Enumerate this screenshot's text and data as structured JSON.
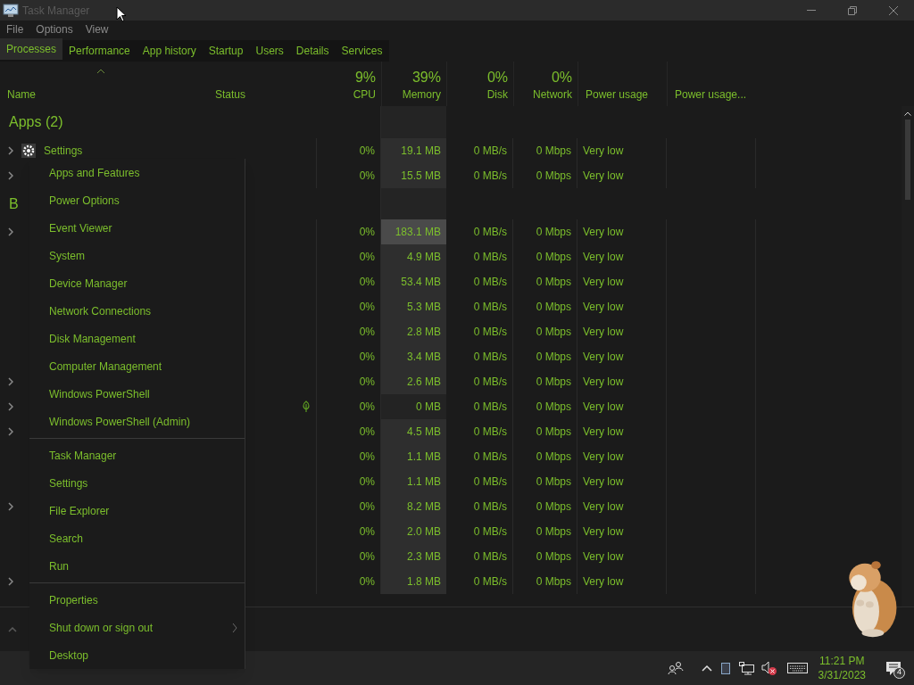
{
  "window": {
    "title": "Task Manager"
  },
  "menu_bar": [
    "File",
    "Options",
    "View"
  ],
  "tabs": [
    {
      "label": "Processes",
      "selected": true
    },
    {
      "label": "Performance",
      "selected": false
    },
    {
      "label": "App history",
      "selected": false
    },
    {
      "label": "Startup",
      "selected": false
    },
    {
      "label": "Users",
      "selected": false
    },
    {
      "label": "Details",
      "selected": false
    },
    {
      "label": "Services",
      "selected": false
    }
  ],
  "columns": [
    {
      "label": "Name",
      "sorted": true
    },
    {
      "label": "Status",
      "sorted": false
    },
    {
      "label": "CPU",
      "total": "9%",
      "sorted": false
    },
    {
      "label": "Memory",
      "total": "39%",
      "sorted": false
    },
    {
      "label": "Disk",
      "total": "0%",
      "sorted": false
    },
    {
      "label": "Network",
      "total": "0%",
      "sorted": false
    },
    {
      "label": "Power usage",
      "sorted": false
    },
    {
      "label": "Power usage...",
      "sorted": false
    }
  ],
  "groups": [
    {
      "title": "Apps (2)",
      "rows": [
        {
          "expandable": true,
          "has_icon": true,
          "name": "Settings",
          "efficiency_mode": false,
          "cpu": "0%",
          "memory": "19.1 MB",
          "disk": "0 MB/s",
          "network": "0 Mbps",
          "power": "Very low",
          "kind": "normal"
        },
        {
          "expandable": true,
          "has_icon": false,
          "efficiency_mode": false,
          "cpu": "0%",
          "memory": "15.5 MB",
          "disk": "0 MB/s",
          "network": "0 Mbps",
          "power": "Very low",
          "kind": "normal"
        }
      ]
    },
    {
      "title": "B",
      "rows": [
        {
          "expandable": true,
          "has_icon": false,
          "efficiency_mode": false,
          "cpu": "0%",
          "memory": "183.1 MB",
          "disk": "0 MB/s",
          "network": "0 Mbps",
          "power": "Very low",
          "kind": "high"
        },
        {
          "expandable": false,
          "has_icon": false,
          "efficiency_mode": false,
          "cpu": "0%",
          "memory": "4.9 MB",
          "disk": "0 MB/s",
          "network": "0 Mbps",
          "power": "Very low",
          "kind": "normal"
        },
        {
          "expandable": false,
          "has_icon": false,
          "efficiency_mode": false,
          "cpu": "0%",
          "memory": "53.4 MB",
          "disk": "0 MB/s",
          "network": "0 Mbps",
          "power": "Very low",
          "kind": "normal"
        },
        {
          "expandable": false,
          "has_icon": false,
          "efficiency_mode": false,
          "cpu": "0%",
          "memory": "5.3 MB",
          "disk": "0 MB/s",
          "network": "0 Mbps",
          "power": "Very low",
          "kind": "normal"
        },
        {
          "expandable": false,
          "has_icon": false,
          "efficiency_mode": false,
          "cpu": "0%",
          "memory": "2.8 MB",
          "disk": "0 MB/s",
          "network": "0 Mbps",
          "power": "Very low",
          "kind": "normal"
        },
        {
          "expandable": false,
          "has_icon": false,
          "efficiency_mode": false,
          "cpu": "0%",
          "memory": "3.4 MB",
          "disk": "0 MB/s",
          "network": "0 Mbps",
          "power": "Very low",
          "kind": "normal"
        },
        {
          "expandable": true,
          "has_icon": false,
          "efficiency_mode": false,
          "cpu": "0%",
          "memory": "2.6 MB",
          "disk": "0 MB/s",
          "network": "0 Mbps",
          "power": "Very low",
          "kind": "normal"
        },
        {
          "expandable": true,
          "has_icon": false,
          "efficiency_mode": true,
          "cpu": "0%",
          "memory": "0 MB",
          "disk": "0 MB/s",
          "network": "0 Mbps",
          "power": "Very low",
          "kind": "low"
        },
        {
          "expandable": true,
          "has_icon": false,
          "efficiency_mode": false,
          "cpu": "0%",
          "memory": "4.5 MB",
          "disk": "0 MB/s",
          "network": "0 Mbps",
          "power": "Very low",
          "kind": "normal"
        },
        {
          "expandable": false,
          "has_icon": false,
          "efficiency_mode": false,
          "cpu": "0%",
          "memory": "1.1 MB",
          "disk": "0 MB/s",
          "network": "0 Mbps",
          "power": "Very low",
          "kind": "normal"
        },
        {
          "expandable": false,
          "has_icon": false,
          "efficiency_mode": false,
          "cpu": "0%",
          "memory": "1.1 MB",
          "disk": "0 MB/s",
          "network": "0 Mbps",
          "power": "Very low",
          "kind": "normal"
        },
        {
          "expandable": true,
          "has_icon": false,
          "efficiency_mode": false,
          "cpu": "0%",
          "memory": "8.2 MB",
          "disk": "0 MB/s",
          "network": "0 Mbps",
          "power": "Very low",
          "kind": "normal"
        },
        {
          "expandable": false,
          "has_icon": false,
          "efficiency_mode": false,
          "cpu": "0%",
          "memory": "2.0 MB",
          "disk": "0 MB/s",
          "network": "0 Mbps",
          "power": "Very low",
          "kind": "normal"
        },
        {
          "expandable": false,
          "has_icon": false,
          "efficiency_mode": false,
          "cpu": "0%",
          "memory": "2.3 MB",
          "disk": "0 MB/s",
          "network": "0 Mbps",
          "power": "Very low",
          "kind": "normal"
        },
        {
          "expandable": true,
          "has_icon": false,
          "efficiency_mode": false,
          "cpu": "0%",
          "memory": "1.8 MB",
          "disk": "0 MB/s",
          "network": "0 Mbps",
          "power": "Very low",
          "kind": "normal"
        }
      ]
    }
  ],
  "context_menu": [
    [
      {
        "label": "Apps and Features"
      },
      {
        "label": "Power Options"
      },
      {
        "label": "Event Viewer"
      },
      {
        "label": "System"
      },
      {
        "label": "Device Manager"
      },
      {
        "label": "Network Connections"
      },
      {
        "label": "Disk Management"
      },
      {
        "label": "Computer Management"
      },
      {
        "label": "Windows PowerShell"
      },
      {
        "label": "Windows PowerShell (Admin)"
      }
    ],
    [
      {
        "label": "Task Manager"
      },
      {
        "label": "Settings"
      },
      {
        "label": "File Explorer"
      },
      {
        "label": "Search"
      },
      {
        "label": "Run"
      }
    ],
    [
      {
        "label": "Properties"
      },
      {
        "label": "Shut down or sign out",
        "submenu": true
      },
      {
        "label": "Desktop"
      }
    ]
  ],
  "taskbar": {
    "time": "11:21 PM",
    "date": "3/31/2023",
    "notifications": "4",
    "volume_muted": true
  }
}
